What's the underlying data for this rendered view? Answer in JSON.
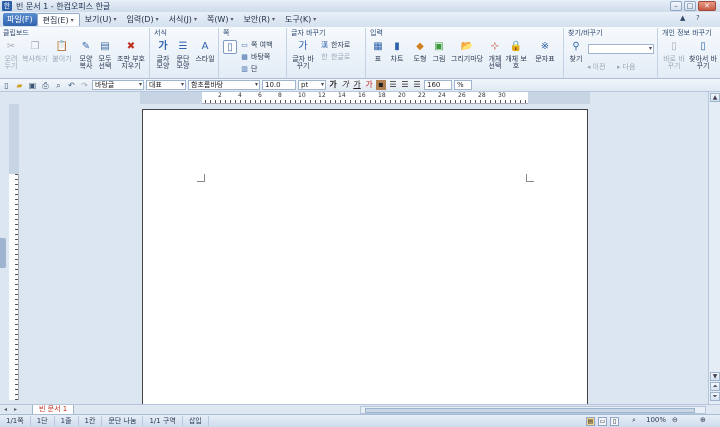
{
  "window": {
    "title": "빈 문서 1 - 한컴오피스 한글",
    "app_icon": "한"
  },
  "menubar": {
    "file": "파일(F)",
    "items": [
      "편집(E)",
      "보기(U)",
      "입력(D)",
      "서식(J)",
      "쪽(W)",
      "보안(R)",
      "도구(K)"
    ]
  },
  "ribbon": {
    "clipboard": {
      "title": "클립보드",
      "cut": "오려 두기",
      "copy": "복사하기",
      "paste": "붙이기",
      "format_copy": "모양 복사",
      "select_all": "모두 선택",
      "delete": "조판 부호 지우기"
    },
    "format": {
      "title": "서식",
      "char_shape": "글자 모양",
      "para_shape": "문단 모양",
      "style": "스타일"
    },
    "page": {
      "title": "쪽",
      "col_width": "쪽 여백",
      "bg": "바탕쪽",
      "col": "단"
    },
    "char_change": {
      "title": "글자 바꾸기",
      "change": "글자 바꾸기",
      "hanja": "한자로",
      "hangul": "한글로"
    },
    "insert": {
      "title": "입력",
      "table": "표",
      "chart": "차트",
      "shape": "도형",
      "picture": "그림",
      "drawing": "그리기마당",
      "obj_select": "개체 선택",
      "obj_protect": "개체 보호",
      "char_table": "문자표"
    },
    "find": {
      "title": "찾기/바꾸기",
      "find": "찾기",
      "prev": "이전",
      "next": "다음"
    },
    "security": {
      "title": "개인 정보 바꾸기",
      "replace": "바로 바꾸기",
      "find_replace": "찾아서 바꾸기"
    }
  },
  "toolbar": {
    "style": "바탕글",
    "lang": "대표",
    "font": "함초롬바탕",
    "size": "10.0",
    "unit": "pt",
    "zoom": "160",
    "zoom_unit": "%",
    "bold": "가",
    "italic": "가",
    "underline": "가"
  },
  "ruler": {
    "ticks": [
      "2",
      "4",
      "6",
      "8",
      "10",
      "12",
      "14",
      "16",
      "18",
      "20",
      "22",
      "24",
      "26",
      "28",
      "30"
    ]
  },
  "tabbar": {
    "doc_tab": "빈 문서 1"
  },
  "status": {
    "page": "1/1쪽",
    "section": "1단",
    "line": "1줄",
    "col": "1칸",
    "para": "문단 나눔",
    "sect": "1/1 구역",
    "mode": "삽입",
    "zoom": "100%"
  },
  "colors": {
    "accent": "#2f63ad",
    "workspace": "#dbe6f1"
  }
}
